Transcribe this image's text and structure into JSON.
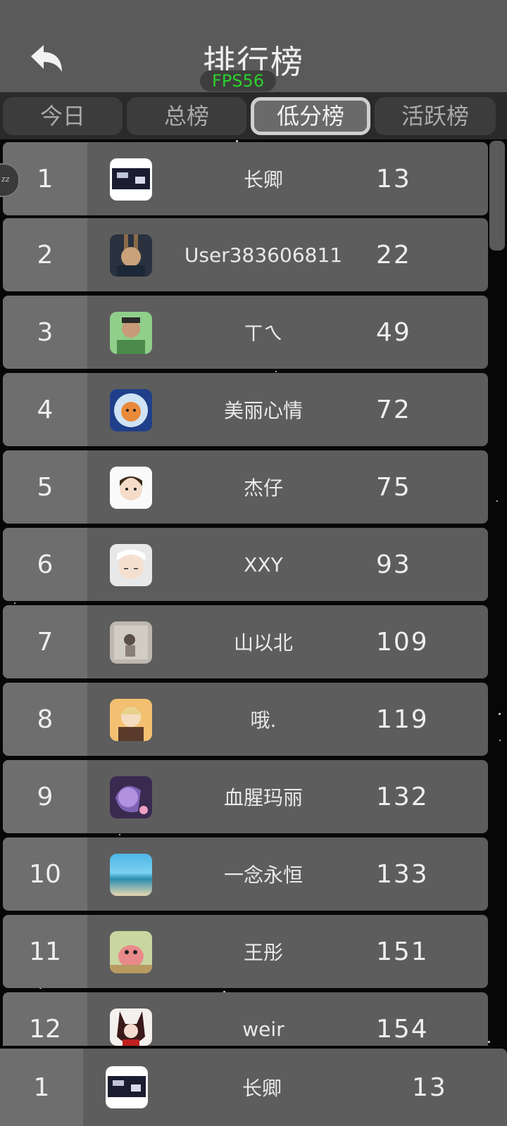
{
  "header": {
    "title": "排行榜",
    "fps": "FPS56"
  },
  "tabs": [
    {
      "label": "今日"
    },
    {
      "label": "总榜"
    },
    {
      "label": "低分榜"
    },
    {
      "label": "活跃榜"
    }
  ],
  "active_tab": "低分榜",
  "rows": [
    {
      "rank": "1",
      "name": "长卿",
      "score": "13"
    },
    {
      "rank": "2",
      "name": "User383606811",
      "score": "22"
    },
    {
      "rank": "3",
      "name": "ㄒㄟ",
      "score": "49"
    },
    {
      "rank": "4",
      "name": "美丽心情",
      "score": "72"
    },
    {
      "rank": "5",
      "name": "杰仔",
      "score": "75"
    },
    {
      "rank": "6",
      "name": "XXY",
      "score": "93"
    },
    {
      "rank": "7",
      "name": "山以北",
      "score": "109"
    },
    {
      "rank": "8",
      "name": "哦.",
      "score": "119"
    },
    {
      "rank": "9",
      "name": "血腥玛丽",
      "score": "132"
    },
    {
      "rank": "10",
      "name": "一念永恒",
      "score": "133"
    },
    {
      "rank": "11",
      "name": "王彤",
      "score": "151"
    },
    {
      "rank": "12",
      "name": "weir",
      "score": "154"
    }
  ],
  "my_rank": {
    "rank": "1",
    "name": "长卿",
    "score": "13"
  },
  "side_badge": "zz",
  "colors": {
    "fps": "#2bd12b",
    "header_bg": "#5a5a5a",
    "row_bg": "#5d5d5d",
    "rank_bg": "#6e6e6e"
  }
}
